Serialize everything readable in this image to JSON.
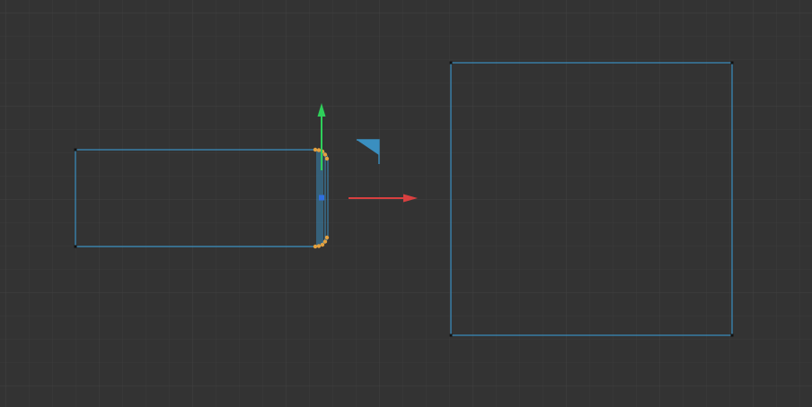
{
  "viewport": {
    "background_color": "#333333",
    "grid_minor_color": "#3b3b3b",
    "grid_major_color": "#424242"
  },
  "objects": {
    "selected_shape": {
      "type": "rectangle-wireframe",
      "outline_color": "#3a8fc0",
      "edge_handle_color": "#e3a03f",
      "pivot_color": "#2f6fe0"
    },
    "square_shape": {
      "type": "square-wireframe",
      "outline_color": "#3a8fc0"
    }
  },
  "gizmo": {
    "y_axis_color": "#2fcf5a",
    "x_axis_color": "#d84040",
    "plane_handle_color": "#3a8fc0",
    "icons": [
      "y-axis-arrow-icon",
      "x-axis-arrow-icon",
      "xy-plane-handle-icon",
      "pivot-point-icon"
    ]
  }
}
